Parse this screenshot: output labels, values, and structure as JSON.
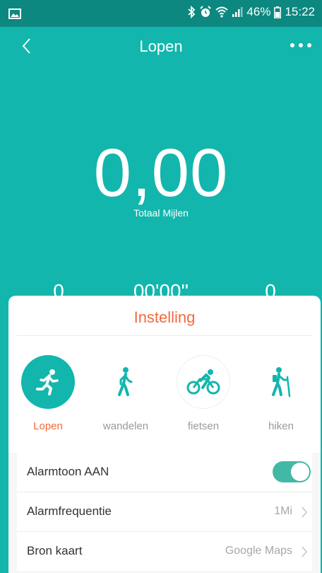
{
  "status_bar": {
    "battery": "46%",
    "time": "15:22"
  },
  "header": {
    "title": "Lopen"
  },
  "summary": {
    "distance_value": "0,00",
    "distance_label": "Totaal Mijlen",
    "stats": [
      "0",
      "00'00''",
      "0"
    ]
  },
  "panel": {
    "title": "Instelling",
    "modes": [
      {
        "label": "Lopen",
        "icon": "running-icon",
        "active": true
      },
      {
        "label": "wandelen",
        "icon": "walking-icon",
        "active": false
      },
      {
        "label": "fietsen",
        "icon": "cycling-icon",
        "active": false
      },
      {
        "label": "hiken",
        "icon": "hiking-icon",
        "active": false
      }
    ],
    "settings": {
      "alarm_tone_label": "Alarmtoon AAN",
      "alarm_tone_on": true,
      "alarm_frequency_label": "Alarmfrequentie",
      "alarm_frequency_value": "1Mi",
      "map_source_label": "Bron kaart",
      "map_source_value": "Google Maps"
    }
  },
  "colors": {
    "primary": "#12b6ad",
    "status_bar": "#0c8880",
    "accent": "#f26a3d",
    "toggle_on": "#44b8a7"
  }
}
